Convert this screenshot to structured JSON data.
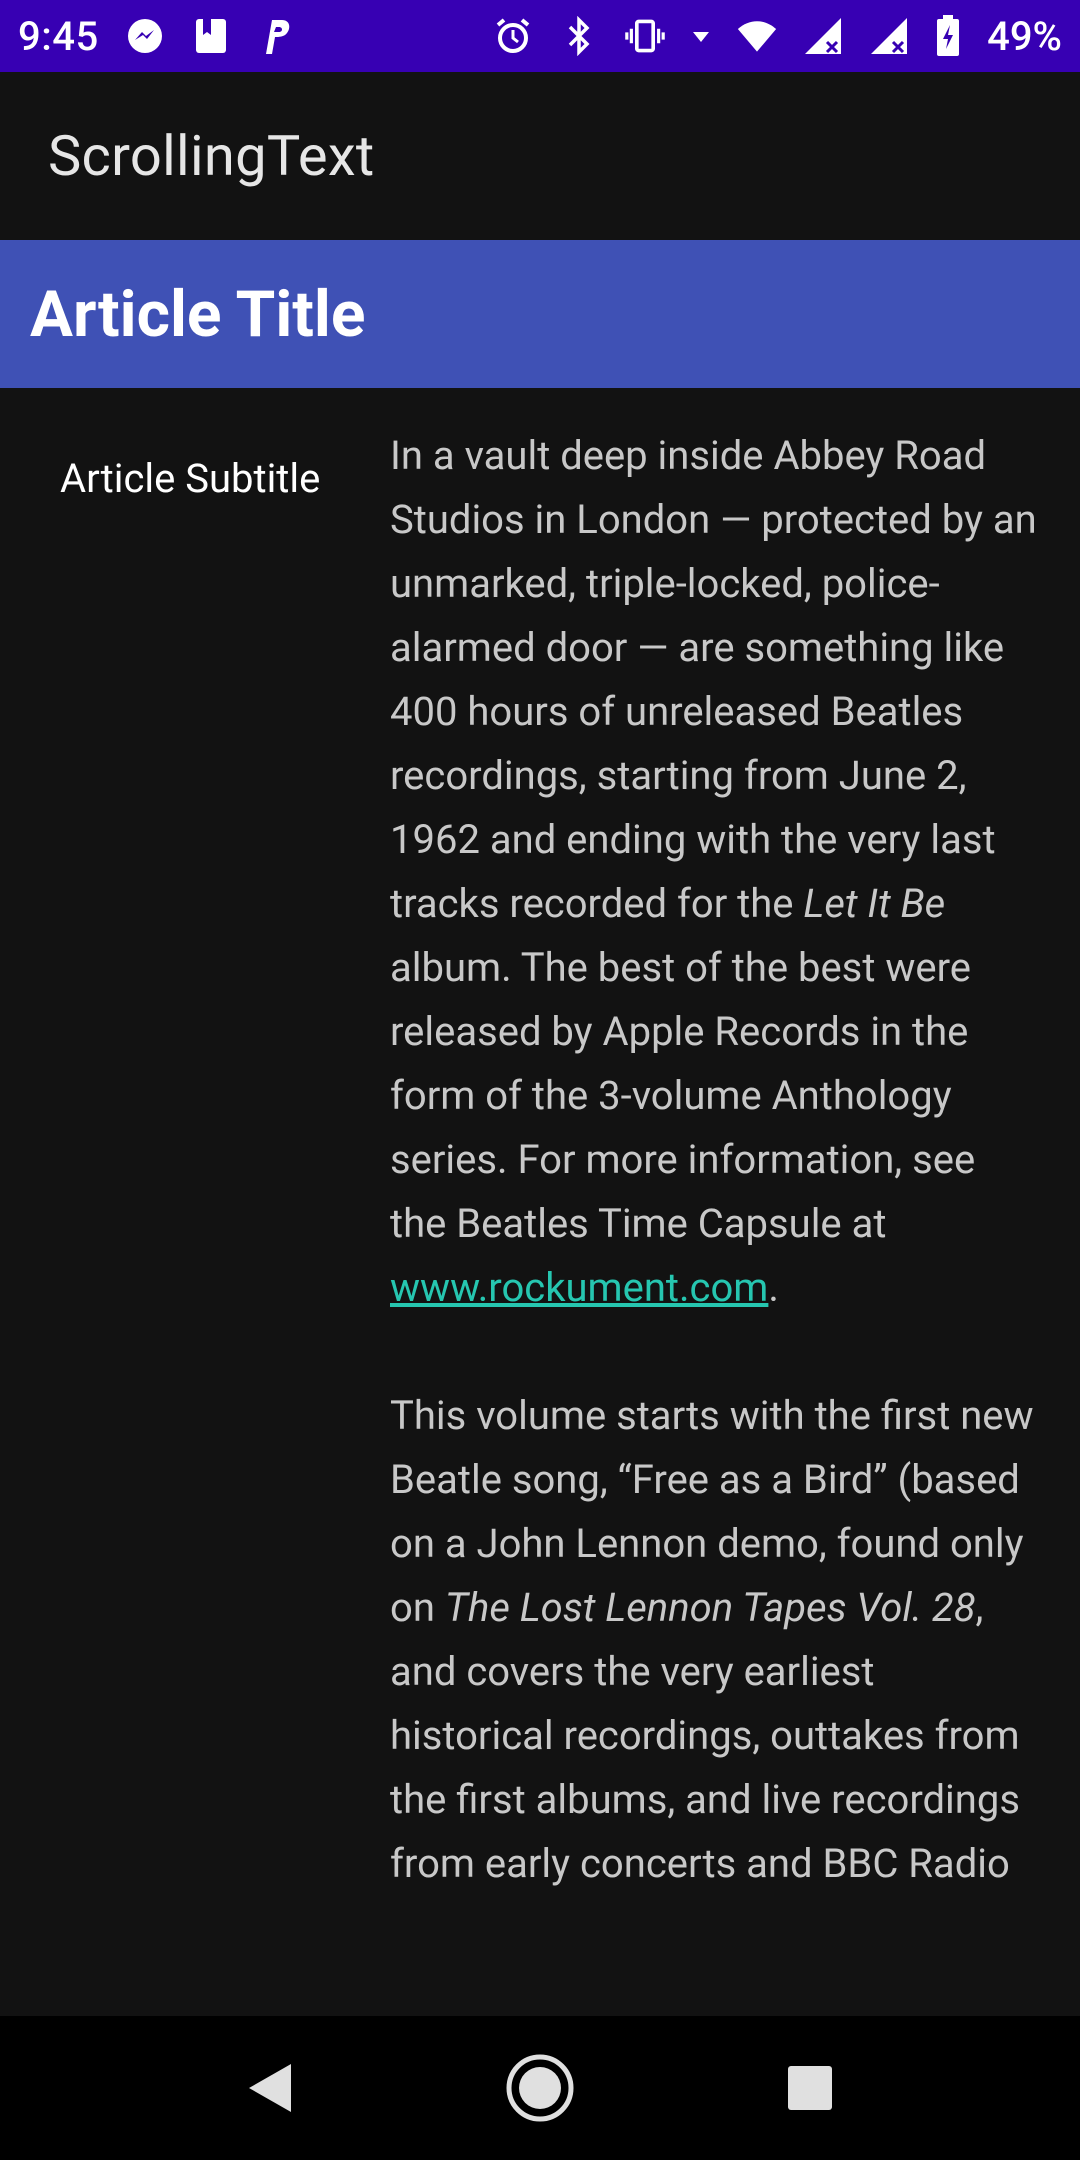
{
  "status_bar": {
    "time": "9:45",
    "left_icons": [
      "messenger-icon",
      "bookmark-app-icon",
      "paypal-icon"
    ],
    "right_icons": [
      "alarm-icon",
      "bluetooth-icon",
      "vibrate-icon",
      "data-arrow-icon",
      "wifi-icon",
      "signal-icon",
      "signal-2-icon",
      "battery-icon"
    ],
    "battery": "49%",
    "color": "#3700b3"
  },
  "app_bar": {
    "title": "ScrollingText"
  },
  "article": {
    "title": "Article Title",
    "title_bg": "#3f51b5",
    "subtitle": "Article Subtitle",
    "p1_part1": "In a vault deep inside Abbey Road Studios in London — protected by an unmarked, triple-locked, police-alarmed door — are something like 400 hours of unreleased Beatles recordings, starting from June 2, 1962 and ending with the very last tracks recorded for the ",
    "p1_italic": "Let It Be",
    "p1_part2": " album. The best of the best were released by Apple Records in the form of the 3-volume Anthology series. For more information, see the Beatles Time Capsule at ",
    "link_text": "www.rockument.com",
    "p1_end": ".",
    "p2_part1": " This volume starts with the first new Beatle song, “Free as a Bird” (based on a John Lennon demo, found only on ",
    "p2_italic": "The Lost Lennon Tapes Vol. 28",
    "p2_part2": ", and covers the very earliest historical recordings, outtakes from the first albums, and live recordings from early concerts and BBC Radio",
    "link_color": "#26c6b0"
  },
  "nav_bar": {
    "buttons": [
      "back-icon",
      "home-icon",
      "recents-icon"
    ]
  }
}
